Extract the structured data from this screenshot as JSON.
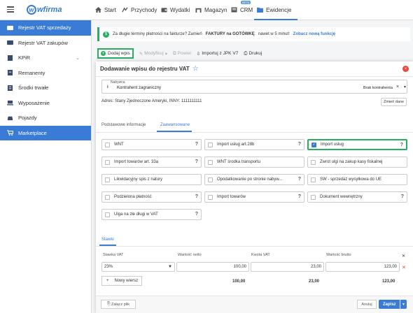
{
  "app": {
    "logo_text": "wfirma",
    "logo_letter": "w"
  },
  "topnav": [
    {
      "label": "Start",
      "icon": "home-icon"
    },
    {
      "label": "Przychody",
      "icon": "income-icon"
    },
    {
      "label": "Wydatki",
      "icon": "wallet-icon"
    },
    {
      "label": "Magazyn",
      "icon": "warehouse-icon"
    },
    {
      "label": "CRM",
      "icon": "crm-icon",
      "badge": "BETA"
    },
    {
      "label": "Ewidencje",
      "icon": "folder-icon",
      "active": true
    }
  ],
  "sidebar": {
    "items": [
      {
        "label": "Rejestr VAT sprzedaży",
        "active": true
      },
      {
        "label": "Rejestr VAT zakupów"
      },
      {
        "label": "KPiR",
        "has_children": true
      },
      {
        "label": "Remanenty"
      },
      {
        "label": "Środki trwałe"
      },
      {
        "label": "Wyposażenie"
      },
      {
        "label": "Pojazdy"
      },
      {
        "label": "Marketplace",
        "active": true
      }
    ]
  },
  "info_bar": {
    "icon": "$",
    "text1": "Za długie terminy płatności na fakturze? Zamień",
    "bold": "FAKTURY na GOTÓWKĘ",
    "text2": "nawet w 5 minut!",
    "link": "Zobacz nową funkcję"
  },
  "toolbar": {
    "add": "Dodaj wpis",
    "modify": "Modyfikuj",
    "repeat": "Powiel",
    "import": "Importuj z JPK V7",
    "print": "Drukuj"
  },
  "modal": {
    "title": "Dodawanie wpisu do rejestru VAT",
    "buyer": {
      "label": "Nabywca",
      "value": "Kontrahent zagraniczny",
      "type": "Brak kontrahenta",
      "clear": "×",
      "dropdown": "▼",
      "info_icon": "i"
    },
    "address": "Adres: Stany Zjednoczone Ameryki, INNY: 1111111111",
    "change_button": "Zmień dane",
    "tabs": [
      {
        "label": "Podstawowe informacje",
        "active": false
      },
      {
        "label": "Zaawansowane",
        "active": true
      }
    ],
    "checkboxes": [
      {
        "label": "WNT",
        "checked": false,
        "help": "?"
      },
      {
        "label": "Import usług art.28b",
        "checked": false,
        "help": "?"
      },
      {
        "label": "Import usług",
        "checked": true,
        "help": "?"
      },
      {
        "label": "Import towarów art. 33a",
        "checked": false,
        "help": "?"
      },
      {
        "label": "WNT środka transportu",
        "checked": false,
        "help": ""
      },
      {
        "label": "Zwrot ulgi na zakup kasy fiskalnej",
        "checked": false,
        "help": ""
      },
      {
        "label": "Likwidacyjny spis z natury",
        "checked": false,
        "help": ""
      },
      {
        "label": "Opodatkowanie po stronie nabyw...",
        "checked": false,
        "help": "?"
      },
      {
        "label": "SW - sprzedaż wysyłkowa do UE",
        "checked": false,
        "help": ""
      },
      {
        "label": "Podzielona płatność",
        "checked": false,
        "help": "?"
      },
      {
        "label": "Import towarów",
        "checked": false,
        "help": "?"
      },
      {
        "label": "Dokument wewnętrzny",
        "checked": false,
        "help": "?"
      },
      {
        "label": "Ulga na złe długi w VAT",
        "checked": false,
        "help": "?"
      }
    ],
    "rates_tab": "Stawki",
    "columns": [
      "Stawka VAT",
      "Wartość netto",
      "Kwota VAT",
      "Wartość brutto"
    ],
    "row": {
      "rate": "23%",
      "net": "100,00",
      "vat": "23,00",
      "gross": "123,00"
    },
    "new_row": "Nowy wiersz",
    "totals": {
      "net": "100,00",
      "vat": "23,00",
      "gross": "123,00"
    },
    "attach": "Załącz plik",
    "cancel": "Anuluj",
    "save": "Zapisz"
  },
  "colors": {
    "accent": "#3a7bd5",
    "green": "#27ae60",
    "danger": "#e74c3c"
  }
}
